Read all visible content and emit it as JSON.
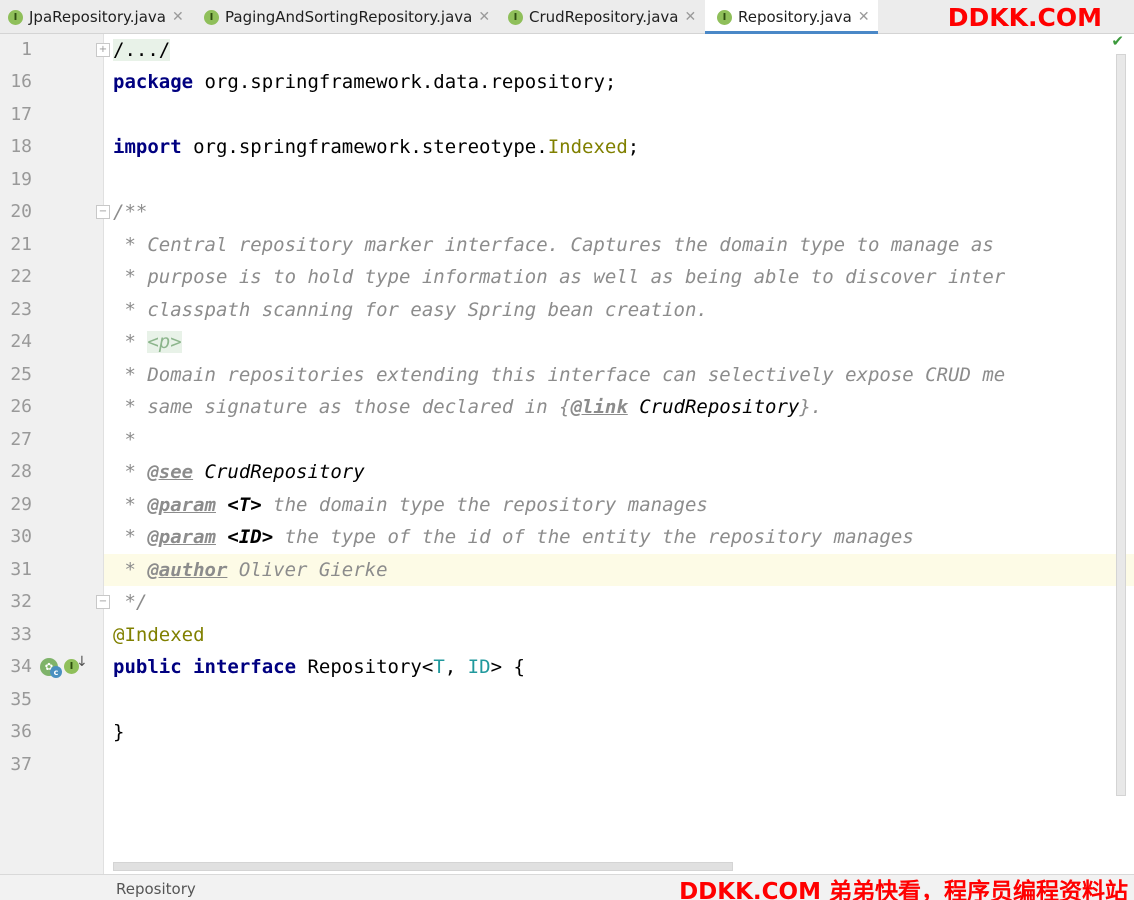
{
  "tabs": [
    {
      "label": "JpaRepository.java",
      "icon": "interface-icon",
      "icon_letter": "I",
      "active": false
    },
    {
      "label": "PagingAndSortingRepository.java",
      "icon": "interface-icon",
      "icon_letter": "I",
      "active": false
    },
    {
      "label": "CrudRepository.java",
      "icon": "interface-icon",
      "icon_letter": "I",
      "active": false
    },
    {
      "label": "Repository.java",
      "icon": "interface-icon",
      "icon_letter": "I",
      "active": true
    }
  ],
  "tab_close_glyph": "✕",
  "watermark": {
    "top": "DDKK.COM",
    "bottom": "DDKK.COM 弟弟快看，程序员编程资料站"
  },
  "breadcrumb": "Repository",
  "line_numbers": [
    "1",
    "16",
    "17",
    "18",
    "19",
    "20",
    "21",
    "22",
    "23",
    "24",
    "25",
    "26",
    "27",
    "28",
    "29",
    "30",
    "31",
    "32",
    "33",
    "34",
    "35",
    "36",
    "37"
  ],
  "highlighted_line": "31",
  "code": {
    "l1": "/.../",
    "l16_kw": "package",
    "l16_rest": " org.springframework.data.repository;",
    "l18_kw": "import",
    "l18_mid": " org.springframework.stereotype.",
    "l18_cls": "Indexed",
    "l18_end": ";",
    "l20": "/**",
    "l21": " * Central repository marker interface. Captures the domain type to manage as",
    "l22": " * purpose is to hold type information as well as being able to discover inter",
    "l23": " * classpath scanning for easy Spring bean creation.",
    "l24_pre": " * ",
    "l24_tag": "<p>",
    "l25": " * Domain repositories extending this interface can selectively expose CRUD me",
    "l26_pre": " * same signature as those declared in {",
    "l26_tag": "@link",
    "l26_ref": " CrudRepository",
    "l26_end": "}.",
    "l27": " *",
    "l28_pre": " * ",
    "l28_tag": "@see",
    "l28_ref": " CrudRepository",
    "l29_pre": " * ",
    "l29_tag": "@param",
    "l29_arg": " <T>",
    "l29_text": " the domain type the repository manages",
    "l30_pre": " * ",
    "l30_tag": "@param",
    "l30_arg": " <ID>",
    "l30_text": " the type of the id of the entity the repository manages",
    "l31_pre": " * ",
    "l31_tag": "@author",
    "l31_text": " Oliver Gierke",
    "l32": " */",
    "l33": "@Indexed",
    "l34_kw1": "public",
    "l34_kw2": "interface",
    "l34_name": " Repository<",
    "l34_t": "T",
    "l34_comma": ", ",
    "l34_id": "ID",
    "l34_end": "> {",
    "l36": "}"
  },
  "colors": {
    "keyword": "#000080",
    "annotation": "#808000",
    "type_param": "#20999d",
    "comment": "#8c8c8c",
    "watermark": "#ff0000",
    "active_tab_underline": "#4a88c7"
  }
}
